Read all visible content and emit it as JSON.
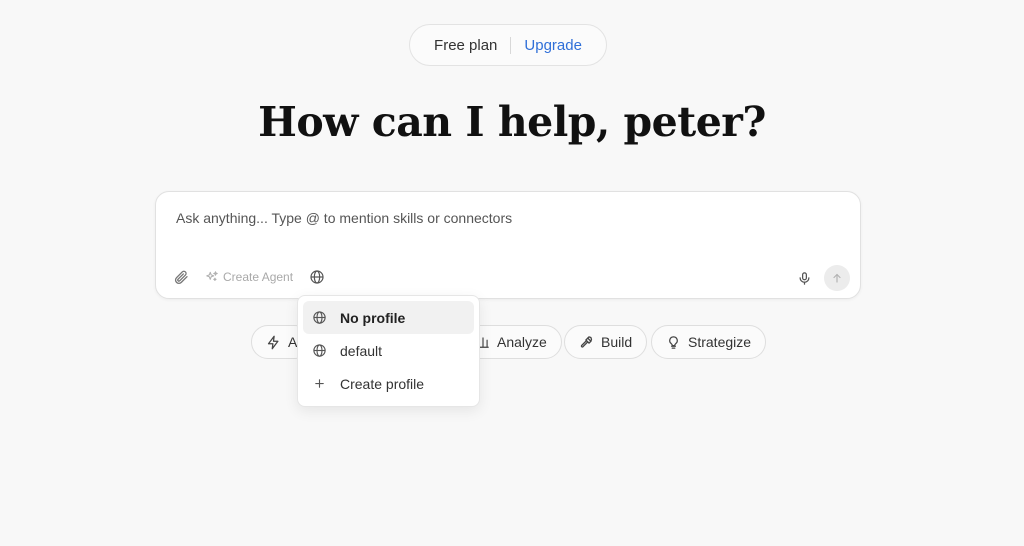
{
  "plan": {
    "label": "Free plan",
    "upgrade_label": "Upgrade"
  },
  "heading": "How can I help, peter?",
  "composer": {
    "placeholder": "Ask anything... Type @ to mention skills or connectors",
    "create_agent_label": "Create Agent",
    "icons": [
      "paperclip-icon",
      "sparkles-icon",
      "globe-icon",
      "microphone-icon",
      "arrow-up-icon"
    ]
  },
  "chips": [
    {
      "label": "A",
      "icon": "lightning-icon"
    },
    {
      "label": "Analyze",
      "icon": "bar-chart-icon"
    },
    {
      "label": "Build",
      "icon": "hammer-icon"
    },
    {
      "label": "Strategize",
      "icon": "lightbulb-icon"
    }
  ],
  "profile_menu": {
    "items": [
      {
        "label": "No profile",
        "icon": "globe-icon",
        "selected": true
      },
      {
        "label": "default",
        "icon": "globe-icon",
        "selected": false
      },
      {
        "label": "Create profile",
        "icon": "plus-icon",
        "selected": false
      }
    ]
  },
  "colors": {
    "accent": "#2f6fd8",
    "background": "#f8f8f8"
  }
}
